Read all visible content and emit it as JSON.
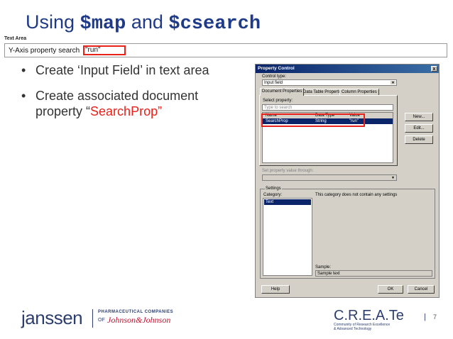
{
  "slide": {
    "title_pre": "Using ",
    "title_code1": "$map",
    "title_mid": " and ",
    "title_code2": "$csearch",
    "page_number": "7"
  },
  "text_area": {
    "label": "Text Area",
    "line_text": "Y-Axis property search",
    "input_value": "\"run\""
  },
  "bullets": {
    "b1": "Create ‘Input Field’ in text area",
    "b2_pre": "Create associated document property “",
    "b2_red": "SearchProp",
    "b2_post": "”"
  },
  "dialog": {
    "title": "Property Control",
    "close": "x",
    "control_type_label": "Control type:",
    "control_type_value": "Input field",
    "tabs": [
      "Document Properties",
      "Data Table Properties",
      "Column Properties"
    ],
    "select_property_label": "Select property:",
    "search_placeholder": "Type to search",
    "columns": [
      "Name",
      "Data Type",
      "Value"
    ],
    "row": {
      "name": "SearchProp",
      "type": "String",
      "value": "\"run\""
    },
    "buttons": {
      "new": "New...",
      "edit": "Edit...",
      "delete": "Delete",
      "help": "Help",
      "ok": "OK",
      "cancel": "Cancel"
    },
    "set_value_label": "Set property value through:",
    "settings_title": "Settings",
    "category_label": "Category:",
    "category_item": "Text",
    "no_settings": "This category does not contain any settings",
    "sample_label": "Sample:",
    "sample_value": "Sample text"
  },
  "footer": {
    "janssen": "janssen",
    "pharma": "PHARMACEUTICAL COMPANIES",
    "of": "OF",
    "jnj": "Johnson&Johnson",
    "create": "C.R.E.A.Te",
    "create_sub1": "Community of Research Excellence",
    "create_sub2": "& Advanced Technology",
    "sep": "|"
  },
  "colors": {
    "title": "#1f3a87",
    "accent_red": "#e8211b",
    "selection": "#0a246a"
  }
}
